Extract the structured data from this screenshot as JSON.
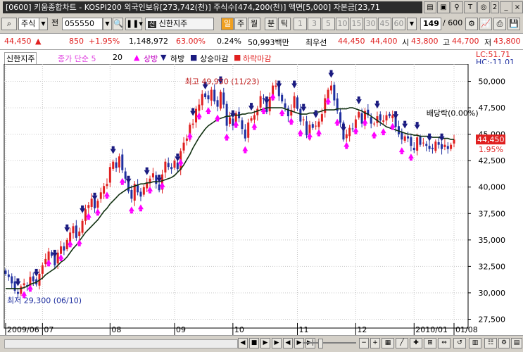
{
  "window": {
    "title": "[0600] 키움종합차트 - KOSPI200 외국인보유[273,742(천)] 주식수[474,200(천)] 액면[5,000] 자본금[23,71",
    "controls": {
      "t_label": "T",
      "num_label": "2"
    }
  },
  "toolbar": {
    "market_select": "주식",
    "prefix_label": "전",
    "code_value": "055550",
    "stock_name": "신한지주",
    "period_day": "일",
    "period_week": "주",
    "period_month": "월",
    "period_min": "분",
    "period_tick": "틱",
    "intervals": [
      "1",
      "3",
      "5",
      "10",
      "15",
      "30",
      "45",
      "60"
    ],
    "count_value": "149",
    "count_total": "/ 600"
  },
  "info": {
    "price": "44,450",
    "change_arrow": "▲",
    "change": "850",
    "change_pct": "+1.95%",
    "volume": "1,148,972",
    "ratio1": "63.00%",
    "ratio2": "0.24%",
    "amount": "50,993백만",
    "pref_label": "최우선",
    "ask": "44,450",
    "bid": "44,400",
    "open_label": "시",
    "open": "43,800",
    "high_label": "고",
    "high": "44,700",
    "low_label": "저",
    "low": "43,800"
  },
  "legend": {
    "name": "신한지주",
    "ma": "종가 단순 5",
    "ma_period": "20",
    "up_label": "상방",
    "down_label": "하방",
    "up_close_label": "상승마감",
    "down_close_label": "하락마감",
    "lc_label": "LC:51.71",
    "hc_label": "HC:-11.01"
  },
  "colors": {
    "up": "#e02020",
    "down": "#2030a0",
    "ma": "#103010",
    "signal_up": "#ff00ff",
    "signal_down": "#1a1a80"
  },
  "chart_data": {
    "type": "candlestick",
    "ylim": [
      27000,
      51500
    ],
    "yticks": [
      27500,
      30000,
      32500,
      35000,
      37500,
      40000,
      42500,
      45000,
      47500,
      50000
    ],
    "ytick_labels": [
      "27,500",
      "30,000",
      "32,500",
      "35,000",
      "37,500",
      "40,000",
      "42,500",
      "45,000",
      "47,500",
      "50,000"
    ],
    "x_labels": [
      {
        "label": "2009/06",
        "index": 0
      },
      {
        "label": "07",
        "index": 12
      },
      {
        "label": "08",
        "index": 34
      },
      {
        "label": "09",
        "index": 55
      },
      {
        "label": "10",
        "index": 74
      },
      {
        "label": "11",
        "index": 95
      },
      {
        "label": "12",
        "index": 114
      },
      {
        "label": "2010/01",
        "index": 133
      },
      {
        "label": "01/08",
        "index": 146
      }
    ],
    "high_annotation": "최고 49,950 (11/23)",
    "low_annotation": "최저 29,300 (06/10)",
    "event_annotation": "배당락(0.00%)",
    "last_price_label": "44,450",
    "last_pct_label": "1.95%",
    "close_path": [
      31800,
      31500,
      30900,
      30200,
      29900,
      30600,
      30900,
      30700,
      31500,
      31100,
      30800,
      31800,
      32600,
      33200,
      33900,
      33500,
      32600,
      33800,
      34400,
      34000,
      35000,
      35700,
      36300,
      35200,
      35800,
      36800,
      37900,
      38300,
      38900,
      38000,
      38700,
      39500,
      40100,
      40300,
      41900,
      42400,
      41800,
      42900,
      41600,
      40800,
      39600,
      38900,
      40300,
      39500,
      39100,
      40000,
      40400,
      40800,
      41300,
      40300,
      39700,
      41200,
      42400,
      41900,
      41700,
      42500,
      41700,
      43400,
      44200,
      44600,
      45900,
      46000,
      47400,
      47800,
      48800,
      48500,
      48300,
      49200,
      48100,
      47600,
      49000,
      47800,
      45800,
      46600,
      45800,
      47000,
      46500,
      45500,
      44600,
      46100,
      46500,
      46800,
      47400,
      48600,
      48300,
      47100,
      48500,
      49600,
      49600,
      48600,
      48100,
      47500,
      46700,
      47300,
      48600,
      47400,
      46200,
      46400,
      44900,
      45900,
      45600,
      45800,
      46200,
      46900,
      48400,
      49200,
      49600,
      48200,
      47200,
      46100,
      44500,
      45000,
      45600,
      45500,
      46400,
      47100,
      46000,
      47200,
      46800,
      46000,
      46000,
      46700,
      46300,
      46300,
      46800,
      46700,
      46800,
      45700,
      45000,
      44500,
      44800,
      44600,
      43900,
      43500,
      44700,
      44000,
      44200,
      43900,
      43600,
      43600,
      44300,
      44000,
      43600,
      44000,
      43600,
      44000,
      44500
    ],
    "ma20": [
      30400,
      30400,
      30400,
      30400,
      30400,
      30400,
      30500,
      30600,
      30800,
      30900,
      31000,
      31200,
      31400,
      31700,
      31900,
      32100,
      32300,
      32600,
      32900,
      33100,
      33400,
      33800,
      34200,
      34500,
      34900,
      35300,
      35700,
      36000,
      36300,
      36600,
      36900,
      37300,
      37700,
      38000,
      38400,
      38700,
      39000,
      39300,
      39500,
      39700,
      39900,
      40000,
      40100,
      40200,
      40300,
      40300,
      40400,
      40400,
      40500,
      40500,
      40500,
      40600,
      40700,
      40800,
      40900,
      41100,
      41400,
      41700,
      42100,
      42600,
      43100,
      43700,
      44200,
      44700,
      45100,
      45500,
      45800,
      46000,
      46200,
      46400,
      46500,
      46600,
      46700,
      46700,
      46800,
      46800,
      46800,
      46900,
      46900,
      47000,
      47000,
      47100,
      47200,
      47300,
      47400,
      47500,
      47500,
      47500,
      47500,
      47500,
      47500,
      47400,
      47300,
      47200,
      47100,
      47000,
      46900,
      46900,
      46900,
      47000,
      47000,
      47100,
      47100,
      47200,
      47300,
      47300,
      47300,
      47300,
      47400,
      47400,
      47400,
      47400,
      47500,
      47500,
      47400,
      47300,
      47200,
      47000,
      46900,
      46700,
      46500,
      46300,
      46100,
      45900,
      45700,
      45600,
      45500,
      45400,
      45300,
      45200,
      45100,
      45000,
      45000,
      44900,
      44900,
      44800,
      44800,
      44800,
      44800,
      44700,
      44700,
      44700,
      44600,
      44600,
      44600,
      44500,
      44500
    ],
    "signal_up_idx": [
      6,
      8,
      14,
      18,
      21,
      24,
      27,
      30,
      33,
      38,
      41,
      44,
      47,
      51,
      57,
      60,
      63,
      66,
      69,
      72,
      75,
      78,
      81,
      84,
      87,
      90,
      93,
      96,
      99,
      102,
      105,
      108,
      111,
      114,
      117,
      120,
      123,
      126,
      129,
      132
    ],
    "signal_down_idx": [
      4,
      10,
      16,
      20,
      25,
      29,
      35,
      40,
      46,
      50,
      56,
      61,
      65,
      70,
      74,
      80,
      85,
      89,
      94,
      97,
      101,
      106,
      110,
      115,
      121,
      127,
      130,
      134,
      138,
      142
    ]
  },
  "bottom": {
    "buttons": [
      "◀",
      "■",
      "▶",
      "▶",
      "◀",
      "▶",
      "▶|"
    ]
  }
}
